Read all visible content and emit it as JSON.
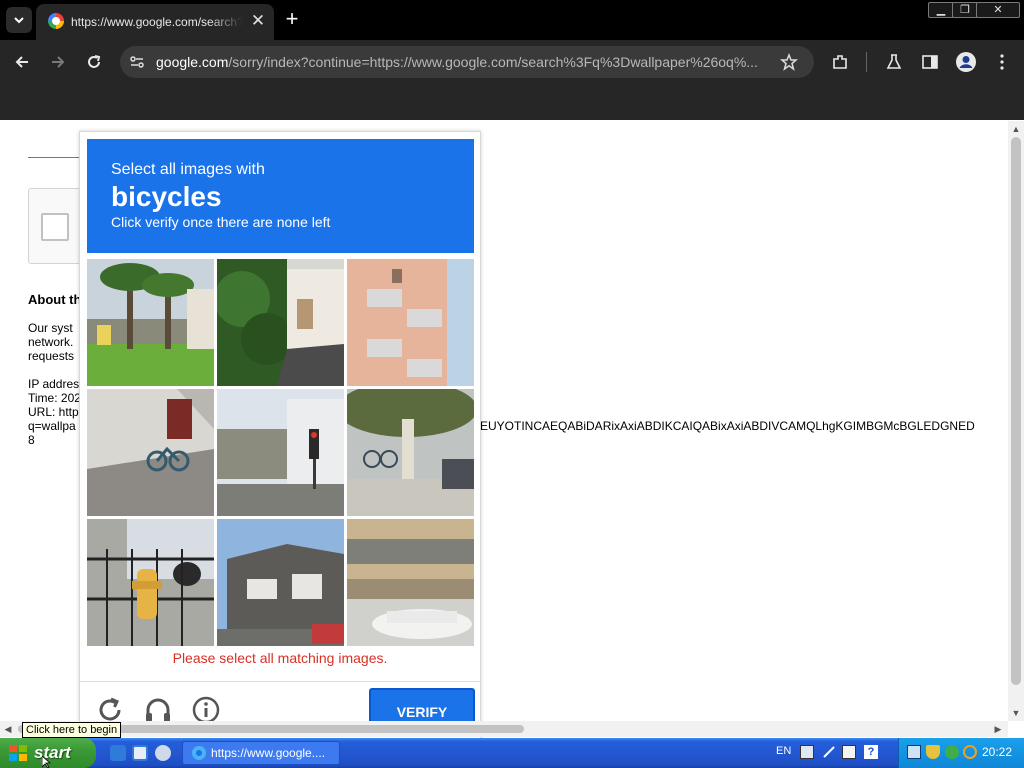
{
  "browser": {
    "tab": {
      "title": "https://www.google.com/search?q=wallpaper"
    },
    "address": {
      "host": "google.com",
      "path": "/sorry/index?continue=https://www.google.com/search%3Fq%3Dwallpaper%26oq%..."
    }
  },
  "page": {
    "about_heading": "About th",
    "paragraph": [
      "Our syst",
      "network.",
      "requests"
    ],
    "details": [
      "IP addres",
      "Time: 202",
      "URL: http",
      "q=wallpa",
      "8"
    ],
    "url_tail": "EUYOTINCAEQABiDARixAxiABDIKCAIQABixAxiABDIVCAMQLhgKGIMBGMcBGLEDGNED"
  },
  "captcha": {
    "instruction": "Select all images with",
    "target": "bicycles",
    "subtext": "Click verify once there are none left",
    "tiles": [
      "palm-trees-street",
      "bushes-building",
      "pink-balcony-building",
      "wall-with-bicycle",
      "traffic-light-street",
      "tree-parked-bicycles",
      "fire-hydrant-car",
      "grey-house",
      "parking-garage-car"
    ],
    "error": "Please select all matching images.",
    "verify_label": "VERIFY"
  },
  "taskbar": {
    "start_label": "start",
    "task_label": "https://www.google....",
    "language": "EN",
    "clock": "20:22"
  },
  "tooltip": "Click here to begin"
}
